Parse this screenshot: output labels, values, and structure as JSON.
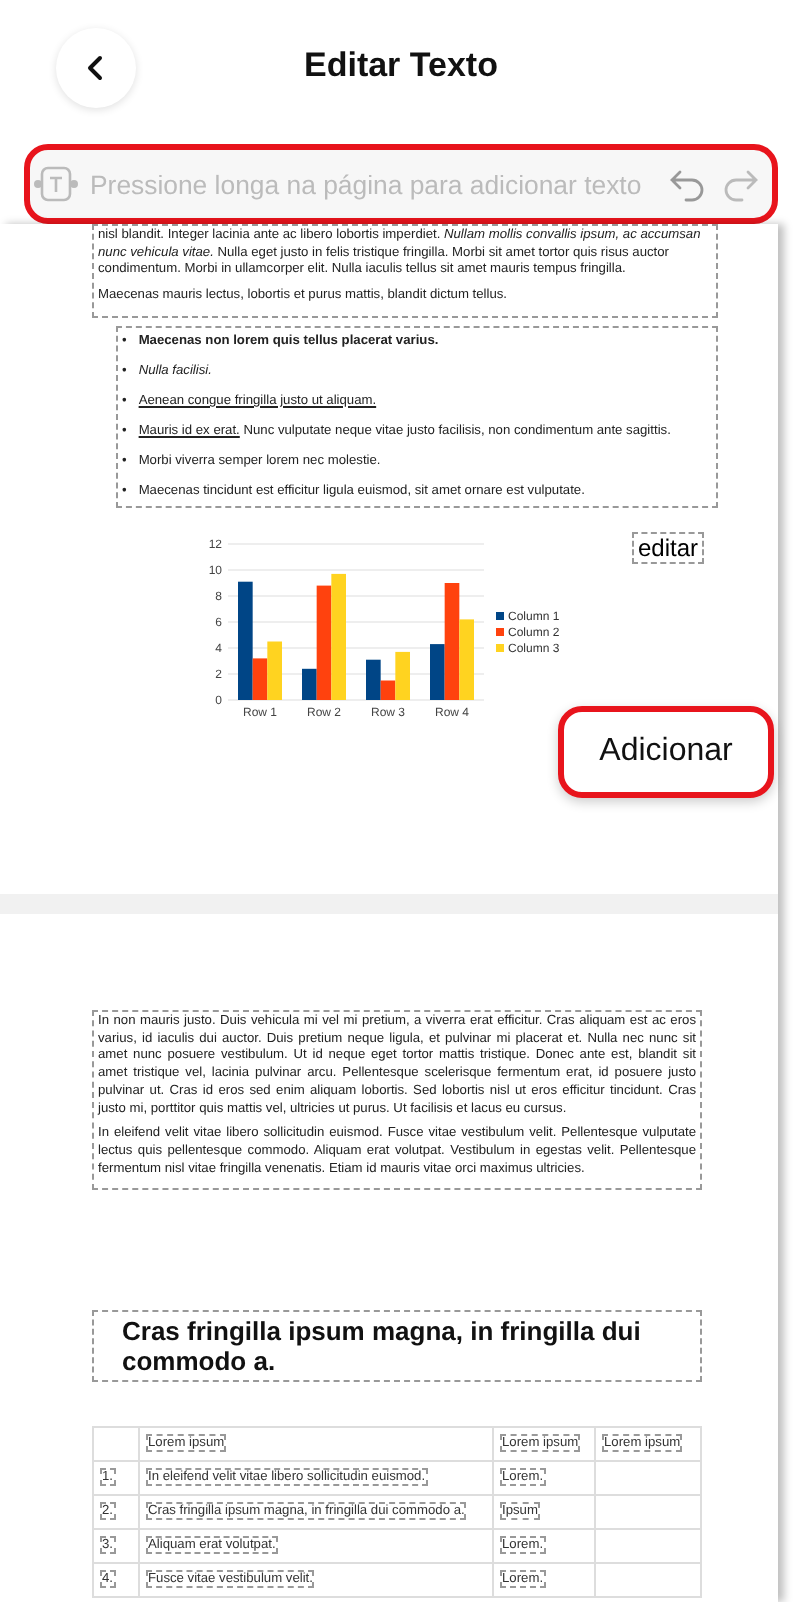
{
  "header": {
    "title": "Editar Texto"
  },
  "toolbar": {
    "placeholder": "Pressione longa na página para adicionar texto",
    "highlighted": true
  },
  "page_1": {
    "paragraphs": [
      "nisl blandit. Integer lacinia ante ac libero lobortis imperdiet. *Nullam mollis convallis ipsum, ac accumsan nunc vehicula vitae.* Nulla eget justo in felis tristique fringilla. Morbi sit amet tortor quis risus auctor condimentum. Morbi in ullamcorper elit. Nulla iaculis tellus sit amet mauris tempus fringilla.",
      "Maecenas mauris lectus, lobortis et purus mattis, blandit dictum tellus."
    ],
    "bullets": [
      {
        "marker": "•",
        "kind": "bold",
        "text": "Maecenas non lorem quis tellus placerat varius."
      },
      {
        "marker": "•",
        "kind": "italic",
        "text": "Nulla facilisi."
      },
      {
        "marker": "•",
        "kind": "link",
        "text": "Aenean congue fringilla justo ut aliquam."
      },
      {
        "marker": "•",
        "kind": "link_lead",
        "link": "Mauris id ex erat.",
        "text": "Nunc vulputate neque vitae justo facilisis, non condimentum ante sagittis."
      },
      {
        "marker": "•",
        "kind": "plain",
        "text": "Morbi viverra semper lorem nec molestie."
      },
      {
        "marker": "•",
        "kind": "plain",
        "text": "Maecenas tincidunt est efficitur ligula euismod, sit amet ornare est vulputate."
      }
    ],
    "chart_data": {
      "type": "bar",
      "grid": true,
      "legend": "right",
      "categories": [
        "Row 1",
        "Row 2",
        "Row 3",
        "Row 4"
      ],
      "ylim": [
        0,
        12
      ],
      "yticks": [
        0,
        2,
        4,
        6,
        8,
        10,
        12
      ],
      "series": [
        {
          "name": "Column 1",
          "color": "#004586",
          "values": [
            9.1,
            2.4,
            3.1,
            4.3
          ]
        },
        {
          "name": "Column 2",
          "color": "#ff420e",
          "values": [
            3.2,
            8.8,
            1.5,
            9.0
          ]
        },
        {
          "name": "Column 3",
          "color": "#ffd320",
          "values": [
            4.5,
            9.7,
            3.7,
            6.2
          ]
        }
      ]
    },
    "text_box": "editar",
    "add_button": {
      "label": "Adicionar",
      "highlighted": true
    }
  },
  "page_2": {
    "paragraphs": [
      "In non mauris justo. Duis vehicula mi vel mi pretium, a viverra erat efficitur. Cras aliquam est ac eros varius, id iaculis dui auctor. Duis pretium neque ligula, et pulvinar mi placerat et. Nulla nec nunc sit amet nunc posuere vestibulum. Ut id neque eget tortor mattis tristique. Donec ante est, blandit sit amet tristique vel, lacinia pulvinar arcu. Pellentesque scelerisque fermentum erat, id posuere justo pulvinar ut. Cras id eros sed enim aliquam lobortis. Sed lobortis nisl ut eros efficitur tincidunt. Cras justo mi, porttitor quis mattis vel, ultricies ut purus. Ut facilisis et lacus eu cursus.",
      "In eleifend velit vitae libero sollicitudin euismod. Fusce vitae vestibulum velit. Pellentesque vulputate lectus quis pellentesque commodo. Aliquam erat volutpat. Vestibulum in egestas velit. Pellentesque fermentum nisl vitae fringilla venenatis. Etiam id mauris vitae orci maximus ultricies."
    ],
    "heading": "Cras fringilla ipsum magna, in fringilla dui commodo a.",
    "table": {
      "columns": [
        "",
        "Lorem ipsum",
        "Lorem ipsum",
        "Lorem ipsum"
      ],
      "rows": [
        [
          "1.",
          "In eleifend velit vitae libero sollicitudin euismod.",
          "Lorem.",
          ""
        ],
        [
          "2.",
          "Cras fringilla ipsum magna, in fringilla dui commodo a.",
          "Ipsum",
          ""
        ],
        [
          "3.",
          "Aliquam erat volutpat.",
          "Lorem.",
          ""
        ],
        [
          "4.",
          "Fusce vitae vestibulum velit.",
          "Lorem.",
          ""
        ]
      ]
    }
  }
}
